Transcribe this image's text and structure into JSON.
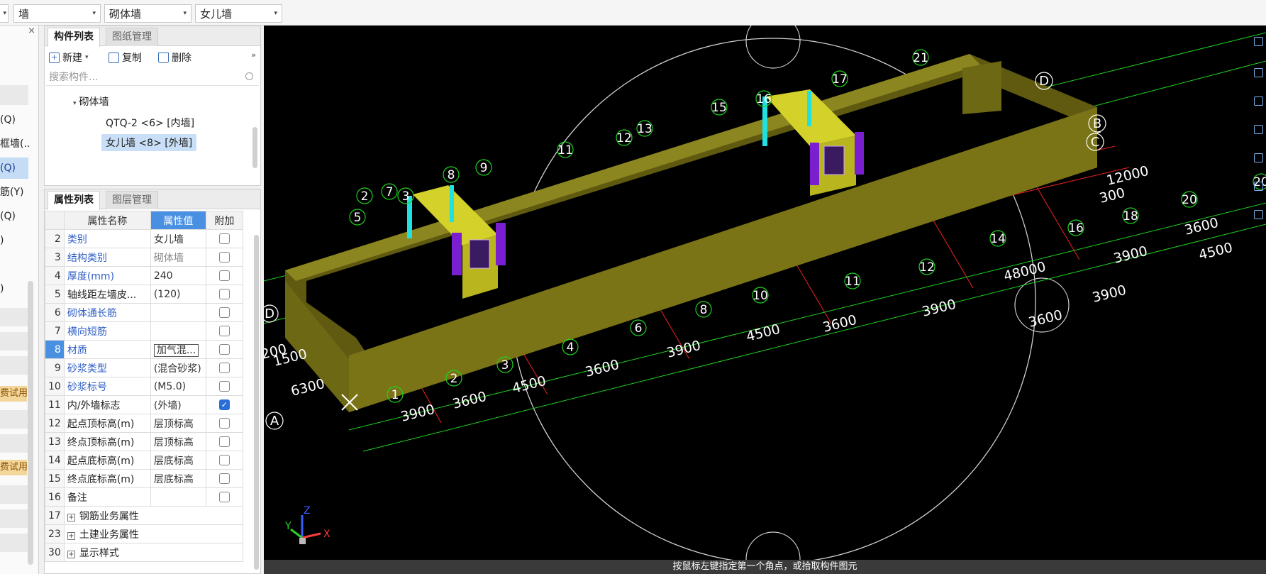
{
  "toolbar": {
    "dropdowns": [
      {
        "value": "墙",
        "label": "element-type"
      },
      {
        "value": "砌体墙",
        "label": "wall-type"
      },
      {
        "value": "女儿墙",
        "label": "component-name"
      }
    ],
    "chevron": "▾"
  },
  "left_strip": {
    "close": "×",
    "items": [
      "(Q)",
      "框墙(..",
      "(Q)",
      "筋(Y)",
      "(Q)",
      ")",
      "",
      ")"
    ],
    "trial_tags": [
      "费试用",
      "费试用"
    ]
  },
  "component_panel": {
    "close": "×",
    "tabs": [
      "构件列表",
      "图纸管理"
    ],
    "tools": {
      "new": "新建",
      "copy": "复制",
      "delete": "删除",
      "more": "»"
    },
    "search_placeholder": "搜索构件...",
    "tree": {
      "group": "砌体墙",
      "items": [
        {
          "label": "QTQ-2 <6> [内墙]",
          "selected": false
        },
        {
          "label": "女儿墙 <8> [外墙]",
          "selected": true
        }
      ]
    }
  },
  "property_panel": {
    "close": "×",
    "tabs": [
      "属性列表",
      "图层管理"
    ],
    "columns": {
      "name": "属性名称",
      "value": "属性值",
      "extra": "附加"
    },
    "rows": [
      {
        "no": "2",
        "name": "类别",
        "value": "女儿墙",
        "checked": false,
        "blue": true
      },
      {
        "no": "3",
        "name": "结构类别",
        "value": "砌体墙",
        "checked": false,
        "blue": true,
        "gray": true
      },
      {
        "no": "4",
        "name": "厚度(mm)",
        "value": "240",
        "checked": false,
        "blue": true
      },
      {
        "no": "5",
        "name": "轴线距左墙皮...",
        "value": "(120)",
        "checked": false,
        "blue": false
      },
      {
        "no": "6",
        "name": "砌体通长筋",
        "value": "",
        "checked": false,
        "blue": true
      },
      {
        "no": "7",
        "name": "横向短筋",
        "value": "",
        "checked": false,
        "blue": true
      },
      {
        "no": "8",
        "name": "材质",
        "value": "加气混...",
        "checked": false,
        "blue": true,
        "editing": true
      },
      {
        "no": "9",
        "name": "砂浆类型",
        "value": "(混合砂浆)",
        "checked": false,
        "blue": true
      },
      {
        "no": "10",
        "name": "砂浆标号",
        "value": "(M5.0)",
        "checked": false,
        "blue": true
      },
      {
        "no": "11",
        "name": "内/外墙标志",
        "value": "(外墙)",
        "checked": true,
        "blue": false
      },
      {
        "no": "12",
        "name": "起点顶标高(m)",
        "value": "层顶标高",
        "checked": false,
        "blue": false
      },
      {
        "no": "13",
        "name": "终点顶标高(m)",
        "value": "层顶标高",
        "checked": false,
        "blue": false
      },
      {
        "no": "14",
        "name": "起点底标高(m)",
        "value": "层底标高",
        "checked": false,
        "blue": false
      },
      {
        "no": "15",
        "name": "终点底标高(m)",
        "value": "层底标高",
        "checked": false,
        "blue": false
      },
      {
        "no": "16",
        "name": "备注",
        "value": "",
        "checked": false,
        "blue": false
      }
    ],
    "groups": [
      {
        "no": "17",
        "name": "钢筋业务属性"
      },
      {
        "no": "23",
        "name": "土建业务属性"
      },
      {
        "no": "30",
        "name": "显示样式"
      }
    ]
  },
  "viewport": {
    "axis_labels": {
      "x": "X",
      "y": "Y",
      "z": "Z"
    },
    "status_text": "按鼠标左键指定第一个角点，或拾取构件图元",
    "grid_numbers": [
      "1",
      "2",
      "3",
      "4",
      "5",
      "6",
      "7",
      "8",
      "9",
      "10",
      "11",
      "12",
      "13",
      "14",
      "15",
      "16",
      "17",
      "18",
      "20",
      "21"
    ],
    "grid_letters": [
      "A",
      "B",
      "C",
      "D"
    ],
    "dimensions": [
      "3900",
      "3600",
      "4500",
      "3600",
      "3900",
      "4500",
      "3600",
      "3900",
      "48000",
      "3900",
      "3600",
      "4500",
      "4500",
      "3600",
      "3900",
      "12000",
      "6300",
      "1500",
      "200",
      "300"
    ],
    "colors": {
      "wall": "#7a7417",
      "opening_wall": "#d4d12a",
      "column": "#7a1fd0",
      "grid": "#1fd21f",
      "axis_red": "#e02020"
    }
  }
}
